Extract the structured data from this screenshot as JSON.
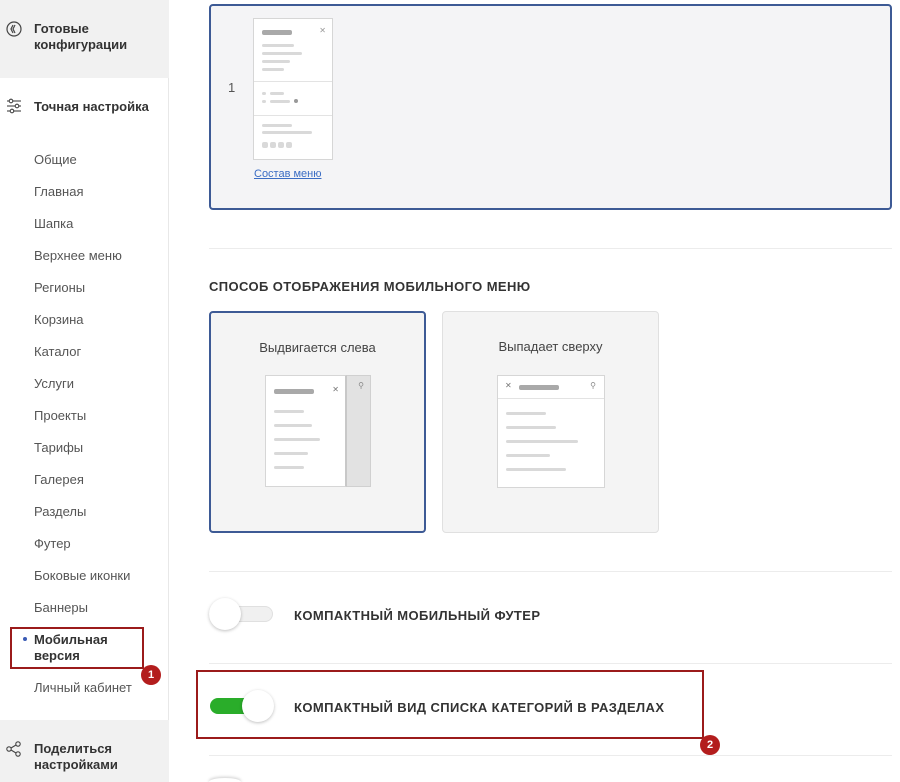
{
  "sidebar": {
    "ready_configs": "Готовые конфигурации",
    "fine_tuning": "Точная настройка",
    "items": [
      {
        "label": "Общие"
      },
      {
        "label": "Главная"
      },
      {
        "label": "Шапка"
      },
      {
        "label": "Верхнее меню"
      },
      {
        "label": "Регионы"
      },
      {
        "label": "Корзина"
      },
      {
        "label": "Каталог"
      },
      {
        "label": "Услуги"
      },
      {
        "label": "Проекты"
      },
      {
        "label": "Тарифы"
      },
      {
        "label": "Галерея"
      },
      {
        "label": "Разделы"
      },
      {
        "label": "Футер"
      },
      {
        "label": "Боковые иконки"
      },
      {
        "label": "Баннеры"
      },
      {
        "label": "Мобильная версия"
      },
      {
        "label": "Личный кабинет"
      }
    ],
    "share_settings": "Поделиться настройками",
    "badge_1": "1"
  },
  "main": {
    "menu_option_number": "1",
    "menu_link": "Состав меню",
    "section_title": "СПОСОБ ОТОБРАЖЕНИЯ МОБИЛЬНОГО МЕНЮ",
    "options": [
      {
        "label": "Выдвигается слева",
        "selected": true
      },
      {
        "label": "Выпадает сверху",
        "selected": false
      }
    ],
    "toggles": [
      {
        "label": "КОМПАКТНЫЙ МОБИЛЬНЫЙ ФУТЕР",
        "on": false
      },
      {
        "label": "КОМПАКТНЫЙ ВИД СПИСКА КАТЕГОРИЙ В РАЗДЕЛАХ",
        "on": true
      }
    ],
    "badge_2": "2"
  },
  "colors": {
    "accent": "#3d5a95",
    "toggle_on": "#2aad2a",
    "toggle_off": "#f0f0f0",
    "highlight_frame": "#9b1b1b"
  }
}
